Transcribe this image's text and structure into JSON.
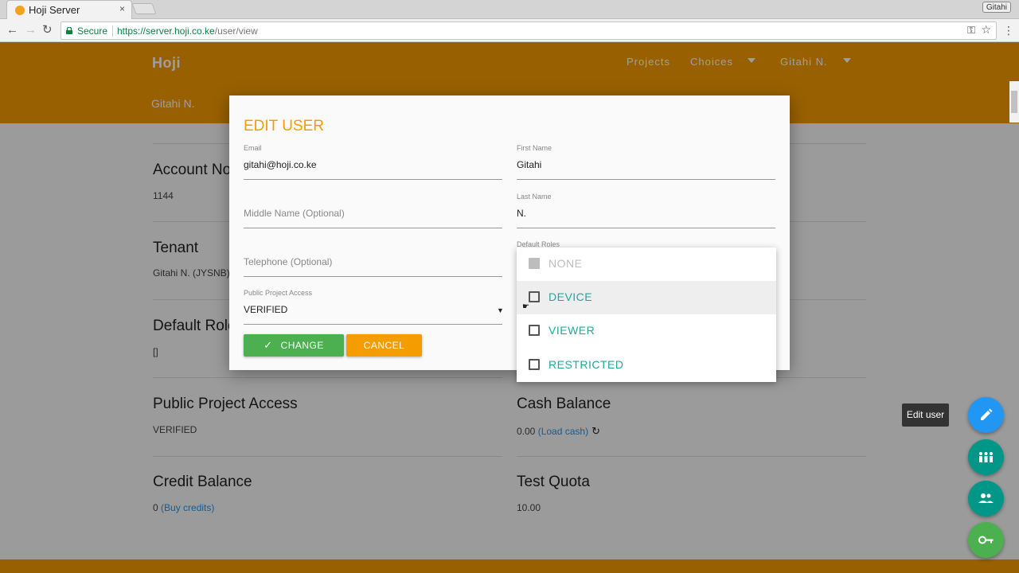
{
  "browser": {
    "tab_title": "Hoji Server",
    "tab_close": "×",
    "profile_name": "Gitahi",
    "secure_label": "Secure",
    "url_base": "https://server.hoji.co.ke",
    "url_path": "/user/view",
    "back_glyph": "←",
    "forward_glyph": "→",
    "reload_glyph": "↻",
    "key_glyph": "⚿",
    "star_glyph": "☆",
    "menu_glyph": "⋮"
  },
  "header": {
    "brand": "Hoji",
    "nav": {
      "projects": "Projects",
      "choices": "Choices",
      "user": "Gitahi N."
    },
    "page_user": "Gitahi N."
  },
  "main": {
    "account_label": "Account No.",
    "account_value": "1144",
    "tenant_label": "Tenant",
    "tenant_value": "Gitahi N. (JYSNB)",
    "default_roles_label": "Default Roles",
    "default_roles_value": "[]",
    "public_access_label": "Public Project Access",
    "public_access_value": "VERIFIED",
    "cash_balance_label": "Cash Balance",
    "cash_balance_value": "0.00",
    "cash_balance_link": "(Load cash)",
    "credit_balance_label": "Credit Balance",
    "credit_balance_value": "0",
    "credit_balance_link": "(Buy credits)",
    "test_quota_label": "Test Quota",
    "test_quota_value": "10.00"
  },
  "modal": {
    "title": "EDIT USER",
    "email_label": "Email",
    "email_value": "gitahi@hoji.co.ke",
    "first_name_label": "First Name",
    "first_name_value": "Gitahi",
    "middle_name_placeholder": "Middle Name (Optional)",
    "last_name_label": "Last Name",
    "last_name_value": "N.",
    "telephone_placeholder": "Telephone (Optional)",
    "default_roles_label": "Default Roles",
    "public_access_label": "Public Project Access",
    "public_access_value": "VERIFIED",
    "change_label": "CHANGE",
    "cancel_label": "CANCEL"
  },
  "roles_dropdown": {
    "options": [
      {
        "label": "NONE",
        "disabled": true
      },
      {
        "label": "DEVICE",
        "disabled": false,
        "hover": true
      },
      {
        "label": "VIEWER",
        "disabled": false
      },
      {
        "label": "RESTRICTED",
        "disabled": false
      }
    ]
  },
  "fabs": {
    "tooltip": "Edit user",
    "edit_icon": "pencil-icon",
    "roles_icon": "group-icon",
    "users_icon": "people-icon",
    "key_icon": "key-icon"
  },
  "colors": {
    "brand_orange": "#f59c00",
    "accent_teal": "#26a69a",
    "change_green": "#4caf50",
    "edit_blue": "#2196f3"
  }
}
